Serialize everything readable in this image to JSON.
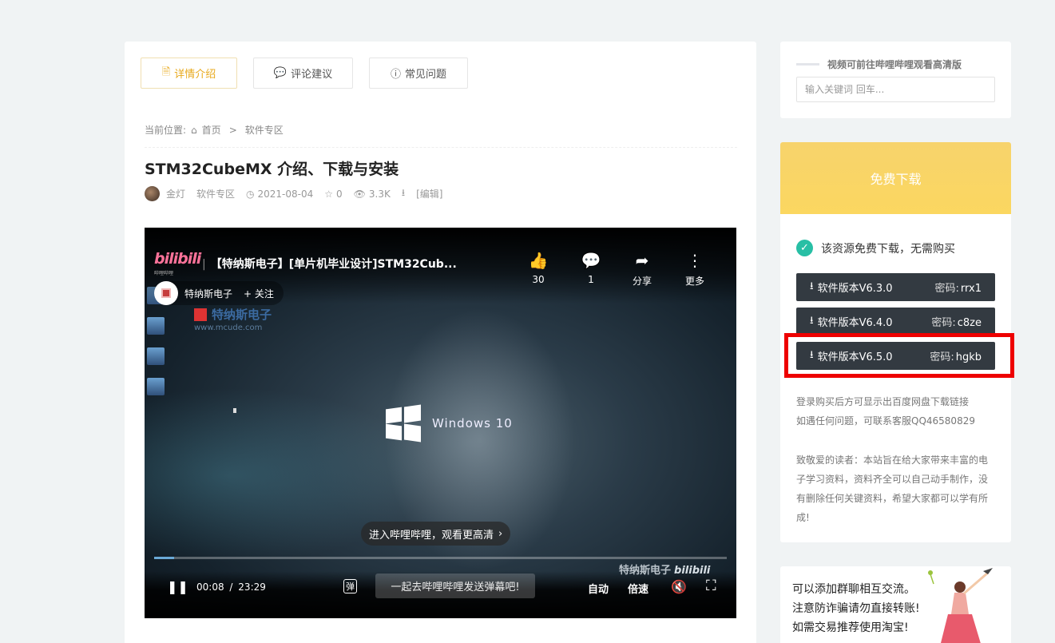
{
  "tabs": [
    {
      "label": "详情介绍",
      "icon": "document-icon",
      "active": true
    },
    {
      "label": "评论建议",
      "icon": "comments-icon",
      "active": false
    },
    {
      "label": "常见问题",
      "icon": "question-icon",
      "active": false
    }
  ],
  "breadcrumb": {
    "prefix": "当前位置:",
    "home": "首页",
    "separator": ">",
    "current": "软件专区"
  },
  "article": {
    "title": "STM32CubeMX 介绍、下载与安装",
    "author": "金灯",
    "category": "软件专区",
    "date": "2021-08-04",
    "stars": "0",
    "views": "3.3K",
    "edit_label": "[编辑]"
  },
  "video": {
    "logo": "bilibili",
    "logo_sub": "哔哩哔哩",
    "title": "【特纳斯电子】[单片机毕业设计]STM32Cub...",
    "actions": [
      {
        "icon": "thumbs-up-icon",
        "label": "30"
      },
      {
        "icon": "comment-icon",
        "label": "1"
      },
      {
        "icon": "share-icon",
        "label": "分享"
      },
      {
        "icon": "more-icon",
        "label": "更多"
      }
    ],
    "uploader": "特纳斯电子",
    "follow_label": "+ 关注",
    "watermark": "特纳斯电子",
    "watermark_url": "www.mcude.com",
    "center_text": "Windows 10",
    "enter_label": "进入哔哩哔哩，观看更高清",
    "current_time": "00:08",
    "time_sep": "/",
    "total_time": "23:29",
    "progress": 0.035,
    "danmaku_placeholder": "一起去哔哩哔哩发送弹幕吧!",
    "danmaku_toggle": "弹",
    "auto_label": "自动",
    "speed_label": "倍速",
    "bottom_watermark": "特纳斯电子",
    "bottom_watermark_logo": "bilibili"
  },
  "sidebar": {
    "notice": "视频可前往哔哩哔哩观看高清版",
    "search_placeholder": "输入关键词 回车...",
    "download_title": "免费下载",
    "free_note": "该资源免费下载，无需购买",
    "downloads": [
      {
        "label": "软件版本V6.3.0",
        "pw_label": "密码:",
        "password": "rrx1"
      },
      {
        "label": "软件版本V6.4.0",
        "pw_label": "密码:",
        "password": "c8ze"
      },
      {
        "label": "软件版本V6.5.0",
        "pw_label": "密码:",
        "password": "hgkb"
      }
    ],
    "login_note_1": "登录购买后方可显示出百度网盘下载链接",
    "login_note_2": "如遇任何问题，可联系客服QQ46580829",
    "reader_note": "致敬爱的读者：本站旨在给大家带来丰富的电子学习资料，资料齐全可以自己动手制作，没有删除任何关键资料，希望大家都可以学有所成!",
    "group_lines": [
      "可以添加群聊相互交流。",
      "注意防诈骗请勿直接转账!",
      "如需交易推荐使用淘宝!"
    ]
  }
}
